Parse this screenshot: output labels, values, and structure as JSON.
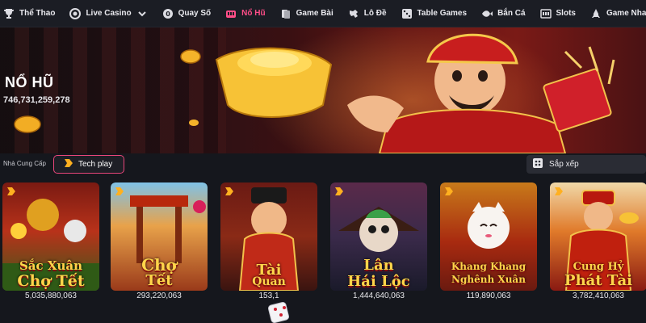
{
  "nav": {
    "items": [
      {
        "label": "Thể Thao",
        "icon": "trophy-icon",
        "active": false
      },
      {
        "label": "Live Casino",
        "icon": "chip-icon",
        "active": false,
        "has_dropdown": true
      },
      {
        "label": "Quay Số",
        "icon": "lottery-ball-icon",
        "active": false
      },
      {
        "label": "Nổ Hũ",
        "icon": "jackpot-icon",
        "active": true
      },
      {
        "label": "Game Bài",
        "icon": "cards-icon",
        "active": false
      },
      {
        "label": "Lô Đề",
        "icon": "dragon-icon",
        "active": false
      },
      {
        "label": "Table Games",
        "icon": "dice-icon",
        "active": false
      },
      {
        "label": "Bắn Cá",
        "icon": "fish-icon",
        "active": false
      },
      {
        "label": "Slots",
        "icon": "slot-machine-icon",
        "active": false
      },
      {
        "label": "Game Nhanh",
        "icon": "rocket-icon",
        "active": false
      }
    ],
    "active_color": "#ff4e88"
  },
  "banner": {
    "title": "NỔ HŨ",
    "jackpot": "746,731,259,278"
  },
  "filters": {
    "provider_label": "Nhà Cung Cấp",
    "provider_selected": "Tech play",
    "sort_label": "Sắp xếp"
  },
  "games": [
    {
      "name_line1": "Sắc Xuân",
      "name_line2": "Chợ Tết",
      "jackpot": "5,035,880,063"
    },
    {
      "name_line1": "Chợ",
      "name_line2": "Tết",
      "jackpot": "293,220,063"
    },
    {
      "name_line1": "Tài",
      "name_line2": "Quan",
      "jackpot": "153,1"
    },
    {
      "name_line1": "Lân",
      "name_line2": "Hái Lộc",
      "jackpot": "1,444,640,063"
    },
    {
      "name_line1": "Khang Khang",
      "name_line2": "Nghênh Xuân",
      "jackpot": "119,890,063"
    },
    {
      "name_line1": "Cung Hỷ",
      "name_line2": "Phát Tài",
      "jackpot": "3,782,410,063"
    }
  ],
  "colors": {
    "accent": "#e8457a",
    "background": "#15171d",
    "title_gold": "#ffd54a"
  }
}
